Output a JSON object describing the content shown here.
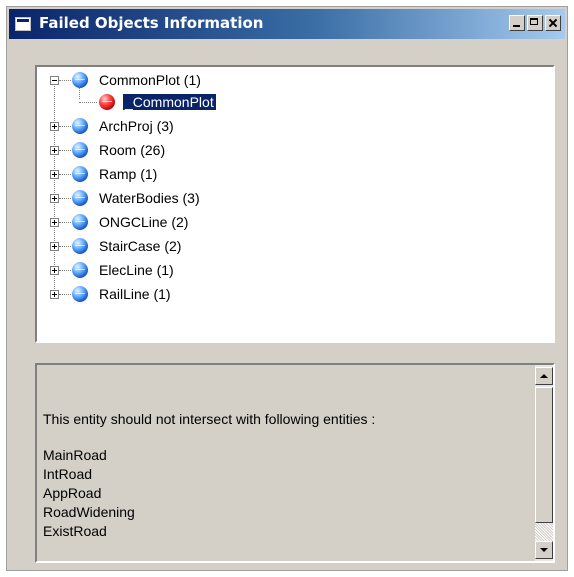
{
  "window": {
    "title": "Failed Objects Information",
    "controls": {
      "minimize": "minimize",
      "maximize": "maximize",
      "close": "close"
    }
  },
  "tree": {
    "root": {
      "label": "CommonPlot (1)",
      "expanded": true,
      "icon": "globe-icon",
      "children": [
        {
          "label": "_CommonPlot",
          "icon": "error-ball-icon",
          "selected": true
        }
      ]
    },
    "items": [
      {
        "label": "ArchProj (3)",
        "icon": "globe-icon"
      },
      {
        "label": "Room (26)",
        "icon": "globe-icon"
      },
      {
        "label": "Ramp (1)",
        "icon": "globe-icon"
      },
      {
        "label": "WaterBodies (3)",
        "icon": "globe-icon"
      },
      {
        "label": "ONGCLine (2)",
        "icon": "globe-icon"
      },
      {
        "label": "StairCase (2)",
        "icon": "globe-icon"
      },
      {
        "label": "ElecLine (1)",
        "icon": "globe-icon"
      },
      {
        "label": "RailLine (1)",
        "icon": "globe-icon"
      }
    ]
  },
  "info": {
    "message": "This entity should not intersect with following entities :",
    "entities": [
      "MainRoad",
      "IntRoad",
      "AppRoad",
      "RoadWidening",
      "ExistRoad"
    ]
  },
  "colors": {
    "titlebar_start": "#0a246a",
    "titlebar_end": "#a6caf0",
    "selection": "#0a246a",
    "face": "#d4d0c8"
  }
}
